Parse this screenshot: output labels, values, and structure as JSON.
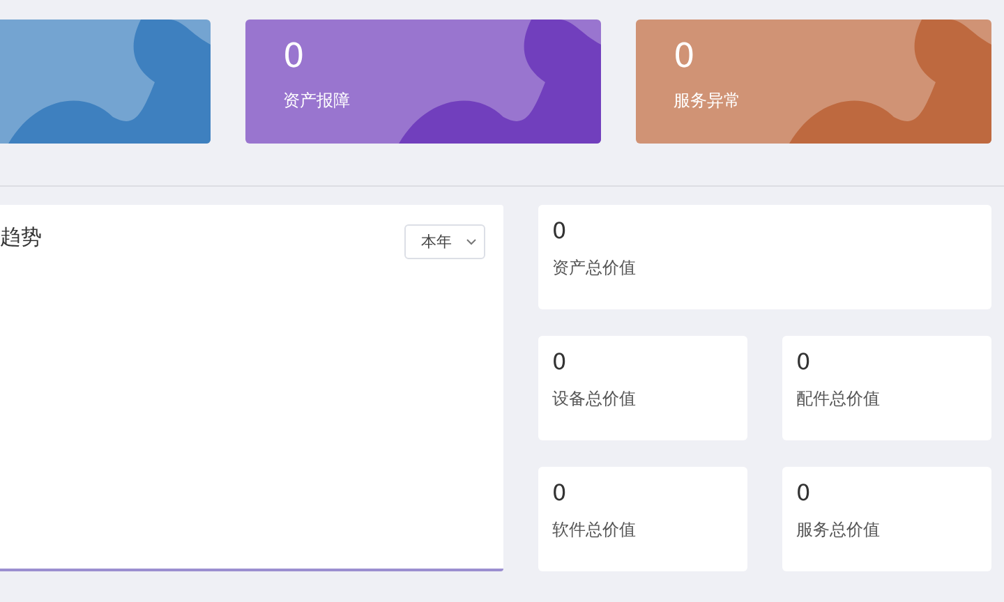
{
  "summary_cards": [
    {
      "color": "#3e80bf"
    },
    {
      "value": "0",
      "label": "资产报障",
      "color": "#713fbd"
    },
    {
      "value": "0",
      "label": "服务异常",
      "color": "#be693f"
    }
  ],
  "trend_panel": {
    "title": "趋势",
    "period_select": "本年"
  },
  "value_cards": [
    {
      "value": "0",
      "label": "资产总价值"
    },
    {
      "value": "0",
      "label": "设备总价值"
    },
    {
      "value": "0",
      "label": "配件总价值"
    },
    {
      "value": "0",
      "label": "软件总价值"
    },
    {
      "value": "0",
      "label": "服务总价值"
    }
  ]
}
